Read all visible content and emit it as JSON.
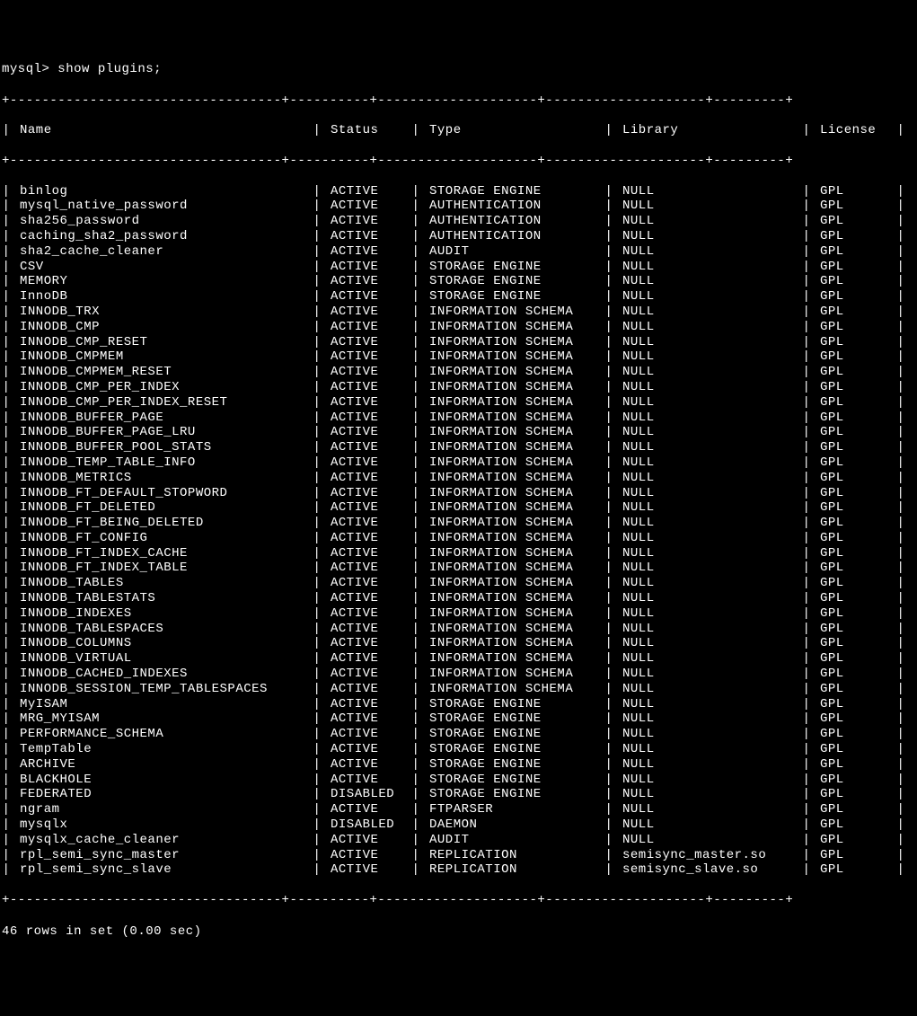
{
  "prompt": "mysql> show plugins;",
  "border_top": "+----------------------------------+----------+--------------------+--------------------+---------+",
  "border_mid": "+----------------------------------+----------+--------------------+--------------------+---------+",
  "border_bottom": "+----------------------------------+----------+--------------------+--------------------+---------+",
  "headers": {
    "name": "Name",
    "status": "Status",
    "type": "Type",
    "library": "Library",
    "license": "License"
  },
  "rows": [
    {
      "name": "binlog",
      "status": "ACTIVE",
      "type": "STORAGE ENGINE",
      "library": "NULL",
      "license": "GPL"
    },
    {
      "name": "mysql_native_password",
      "status": "ACTIVE",
      "type": "AUTHENTICATION",
      "library": "NULL",
      "license": "GPL"
    },
    {
      "name": "sha256_password",
      "status": "ACTIVE",
      "type": "AUTHENTICATION",
      "library": "NULL",
      "license": "GPL"
    },
    {
      "name": "caching_sha2_password",
      "status": "ACTIVE",
      "type": "AUTHENTICATION",
      "library": "NULL",
      "license": "GPL"
    },
    {
      "name": "sha2_cache_cleaner",
      "status": "ACTIVE",
      "type": "AUDIT",
      "library": "NULL",
      "license": "GPL"
    },
    {
      "name": "CSV",
      "status": "ACTIVE",
      "type": "STORAGE ENGINE",
      "library": "NULL",
      "license": "GPL"
    },
    {
      "name": "MEMORY",
      "status": "ACTIVE",
      "type": "STORAGE ENGINE",
      "library": "NULL",
      "license": "GPL"
    },
    {
      "name": "InnoDB",
      "status": "ACTIVE",
      "type": "STORAGE ENGINE",
      "library": "NULL",
      "license": "GPL"
    },
    {
      "name": "INNODB_TRX",
      "status": "ACTIVE",
      "type": "INFORMATION SCHEMA",
      "library": "NULL",
      "license": "GPL"
    },
    {
      "name": "INNODB_CMP",
      "status": "ACTIVE",
      "type": "INFORMATION SCHEMA",
      "library": "NULL",
      "license": "GPL"
    },
    {
      "name": "INNODB_CMP_RESET",
      "status": "ACTIVE",
      "type": "INFORMATION SCHEMA",
      "library": "NULL",
      "license": "GPL"
    },
    {
      "name": "INNODB_CMPMEM",
      "status": "ACTIVE",
      "type": "INFORMATION SCHEMA",
      "library": "NULL",
      "license": "GPL"
    },
    {
      "name": "INNODB_CMPMEM_RESET",
      "status": "ACTIVE",
      "type": "INFORMATION SCHEMA",
      "library": "NULL",
      "license": "GPL"
    },
    {
      "name": "INNODB_CMP_PER_INDEX",
      "status": "ACTIVE",
      "type": "INFORMATION SCHEMA",
      "library": "NULL",
      "license": "GPL"
    },
    {
      "name": "INNODB_CMP_PER_INDEX_RESET",
      "status": "ACTIVE",
      "type": "INFORMATION SCHEMA",
      "library": "NULL",
      "license": "GPL"
    },
    {
      "name": "INNODB_BUFFER_PAGE",
      "status": "ACTIVE",
      "type": "INFORMATION SCHEMA",
      "library": "NULL",
      "license": "GPL"
    },
    {
      "name": "INNODB_BUFFER_PAGE_LRU",
      "status": "ACTIVE",
      "type": "INFORMATION SCHEMA",
      "library": "NULL",
      "license": "GPL"
    },
    {
      "name": "INNODB_BUFFER_POOL_STATS",
      "status": "ACTIVE",
      "type": "INFORMATION SCHEMA",
      "library": "NULL",
      "license": "GPL"
    },
    {
      "name": "INNODB_TEMP_TABLE_INFO",
      "status": "ACTIVE",
      "type": "INFORMATION SCHEMA",
      "library": "NULL",
      "license": "GPL"
    },
    {
      "name": "INNODB_METRICS",
      "status": "ACTIVE",
      "type": "INFORMATION SCHEMA",
      "library": "NULL",
      "license": "GPL"
    },
    {
      "name": "INNODB_FT_DEFAULT_STOPWORD",
      "status": "ACTIVE",
      "type": "INFORMATION SCHEMA",
      "library": "NULL",
      "license": "GPL"
    },
    {
      "name": "INNODB_FT_DELETED",
      "status": "ACTIVE",
      "type": "INFORMATION SCHEMA",
      "library": "NULL",
      "license": "GPL"
    },
    {
      "name": "INNODB_FT_BEING_DELETED",
      "status": "ACTIVE",
      "type": "INFORMATION SCHEMA",
      "library": "NULL",
      "license": "GPL"
    },
    {
      "name": "INNODB_FT_CONFIG",
      "status": "ACTIVE",
      "type": "INFORMATION SCHEMA",
      "library": "NULL",
      "license": "GPL"
    },
    {
      "name": "INNODB_FT_INDEX_CACHE",
      "status": "ACTIVE",
      "type": "INFORMATION SCHEMA",
      "library": "NULL",
      "license": "GPL"
    },
    {
      "name": "INNODB_FT_INDEX_TABLE",
      "status": "ACTIVE",
      "type": "INFORMATION SCHEMA",
      "library": "NULL",
      "license": "GPL"
    },
    {
      "name": "INNODB_TABLES",
      "status": "ACTIVE",
      "type": "INFORMATION SCHEMA",
      "library": "NULL",
      "license": "GPL"
    },
    {
      "name": "INNODB_TABLESTATS",
      "status": "ACTIVE",
      "type": "INFORMATION SCHEMA",
      "library": "NULL",
      "license": "GPL"
    },
    {
      "name": "INNODB_INDEXES",
      "status": "ACTIVE",
      "type": "INFORMATION SCHEMA",
      "library": "NULL",
      "license": "GPL"
    },
    {
      "name": "INNODB_TABLESPACES",
      "status": "ACTIVE",
      "type": "INFORMATION SCHEMA",
      "library": "NULL",
      "license": "GPL"
    },
    {
      "name": "INNODB_COLUMNS",
      "status": "ACTIVE",
      "type": "INFORMATION SCHEMA",
      "library": "NULL",
      "license": "GPL"
    },
    {
      "name": "INNODB_VIRTUAL",
      "status": "ACTIVE",
      "type": "INFORMATION SCHEMA",
      "library": "NULL",
      "license": "GPL"
    },
    {
      "name": "INNODB_CACHED_INDEXES",
      "status": "ACTIVE",
      "type": "INFORMATION SCHEMA",
      "library": "NULL",
      "license": "GPL"
    },
    {
      "name": "INNODB_SESSION_TEMP_TABLESPACES",
      "status": "ACTIVE",
      "type": "INFORMATION SCHEMA",
      "library": "NULL",
      "license": "GPL"
    },
    {
      "name": "MyISAM",
      "status": "ACTIVE",
      "type": "STORAGE ENGINE",
      "library": "NULL",
      "license": "GPL"
    },
    {
      "name": "MRG_MYISAM",
      "status": "ACTIVE",
      "type": "STORAGE ENGINE",
      "library": "NULL",
      "license": "GPL"
    },
    {
      "name": "PERFORMANCE_SCHEMA",
      "status": "ACTIVE",
      "type": "STORAGE ENGINE",
      "library": "NULL",
      "license": "GPL"
    },
    {
      "name": "TempTable",
      "status": "ACTIVE",
      "type": "STORAGE ENGINE",
      "library": "NULL",
      "license": "GPL"
    },
    {
      "name": "ARCHIVE",
      "status": "ACTIVE",
      "type": "STORAGE ENGINE",
      "library": "NULL",
      "license": "GPL"
    },
    {
      "name": "BLACKHOLE",
      "status": "ACTIVE",
      "type": "STORAGE ENGINE",
      "library": "NULL",
      "license": "GPL"
    },
    {
      "name": "FEDERATED",
      "status": "DISABLED",
      "type": "STORAGE ENGINE",
      "library": "NULL",
      "license": "GPL"
    },
    {
      "name": "ngram",
      "status": "ACTIVE",
      "type": "FTPARSER",
      "library": "NULL",
      "license": "GPL"
    },
    {
      "name": "mysqlx",
      "status": "DISABLED",
      "type": "DAEMON",
      "library": "NULL",
      "license": "GPL"
    },
    {
      "name": "mysqlx_cache_cleaner",
      "status": "ACTIVE",
      "type": "AUDIT",
      "library": "NULL",
      "license": "GPL"
    },
    {
      "name": "rpl_semi_sync_master",
      "status": "ACTIVE",
      "type": "REPLICATION",
      "library": "semisync_master.so",
      "license": "GPL"
    },
    {
      "name": "rpl_semi_sync_slave",
      "status": "ACTIVE",
      "type": "REPLICATION",
      "library": "semisync_slave.so",
      "license": "GPL"
    }
  ],
  "footer": "46 rows in set (0.00 sec)"
}
